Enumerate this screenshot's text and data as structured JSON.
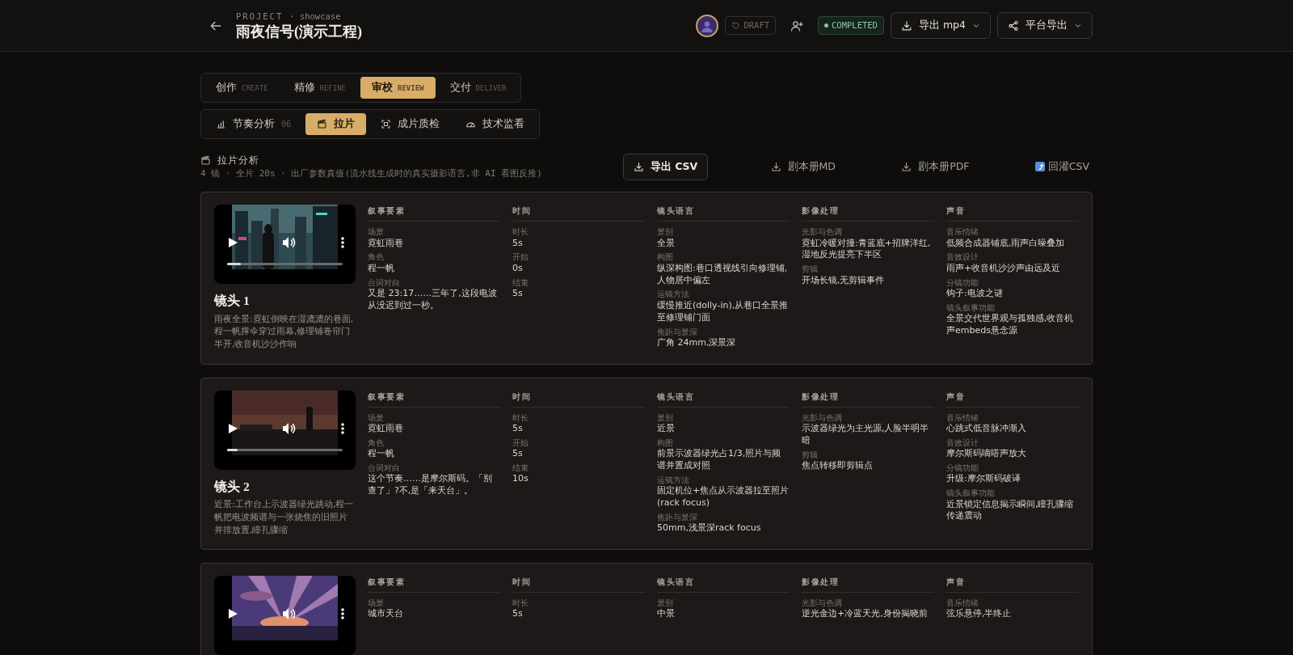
{
  "header": {
    "project_label": "PROJECT",
    "project_sub": "· showcase",
    "title": "雨夜信号(演示工程)",
    "draft": "DRAFT",
    "status": "COMPLETED",
    "buttons": [
      {
        "label": "导出 mp4",
        "kind": "download"
      },
      {
        "label": "平台导出",
        "kind": "share"
      }
    ]
  },
  "stage_tabs": [
    {
      "label": "创作",
      "sub": "CREATE",
      "selected": false
    },
    {
      "label": "精修",
      "sub": "REFINE",
      "selected": false
    },
    {
      "label": "审校",
      "sub": "REVIEW",
      "selected": true
    },
    {
      "label": "交付",
      "sub": "DELIVER",
      "selected": false
    }
  ],
  "sub_tabs": [
    {
      "label": "节奏分析",
      "count": "06",
      "kind": "chart",
      "selected": false
    },
    {
      "label": "拉片",
      "kind": "clapper",
      "selected": true
    },
    {
      "label": "成片质检",
      "kind": "scan",
      "selected": false
    },
    {
      "label": "技术监看",
      "kind": "gauge",
      "selected": false
    }
  ],
  "section": {
    "title": "拉片分析",
    "summary": "4 镜 · 全片 20s · 出厂参数真值(流水线生成时的真实摄影语言,非 AI 看图反推)"
  },
  "actions": [
    {
      "label": "导出 CSV",
      "kind": "primary"
    },
    {
      "label": "剧本册MD",
      "kind": "link"
    },
    {
      "label": "剧本册PDF",
      "kind": "link"
    },
    {
      "label": "回灌CSV",
      "kind": "import"
    }
  ],
  "shots": [
    {
      "title": "镜头 1",
      "description": "雨夜全景:霓虹倒映在湿漉漉的巷面,程一帆撑伞穿过雨幕,修理铺卷帘门半开,收音机沙沙作响",
      "level": 0.12,
      "groups": [
        {
          "heading": "叙事要素",
          "fields": [
            {
              "label": "场景",
              "value": "霓虹雨巷"
            },
            {
              "label": "角色",
              "value": "程一帆"
            },
            {
              "label": "台词对白",
              "value": "又是 23:17……三年了,这段电波从没迟到过一秒。"
            }
          ]
        },
        {
          "heading": "时间",
          "fields": [
            {
              "label": "时长",
              "value": "5s"
            },
            {
              "label": "开始",
              "value": "0s"
            },
            {
              "label": "结束",
              "value": "5s"
            }
          ]
        },
        {
          "heading": "镜头语言",
          "fields": [
            {
              "label": "景别",
              "value": "全景"
            },
            {
              "label": "构图",
              "value": "纵深构图:巷口透视线引向修理铺,人物居中偏左"
            },
            {
              "label": "运镜方法",
              "value": "缓慢推近(dolly-in),从巷口全景推至修理铺门面"
            },
            {
              "label": "焦距与景深",
              "value": "广角 24mm,深景深"
            }
          ]
        },
        {
          "heading": "影像处理",
          "fields": [
            {
              "label": "光影与色调",
              "value": "霓虹冷暖对撞:青蓝底+招牌洋红,湿地反光提亮下半区"
            },
            {
              "label": "剪辑",
              "value": "开场长镜,无剪辑事件"
            }
          ]
        },
        {
          "heading": "声音",
          "fields": [
            {
              "label": "音乐情绪",
              "value": "低频合成器铺底,雨声白噪叠加"
            },
            {
              "label": "音效设计",
              "value": "雨声+收音机沙沙声由远及近"
            },
            {
              "label": "分镜功能",
              "value": "钩子:电波之谜"
            },
            {
              "label": "镜头叙事功能",
              "value": "全景交代世界观与孤独感,收音机声embeds悬念源"
            }
          ]
        }
      ]
    },
    {
      "title": "镜头 2",
      "description": "近景:工作台上示波器绿光跳动,程一帆把电波频谱与一张烧焦的旧照片并排放置,瞳孔骤缩",
      "level": 0.09,
      "groups": [
        {
          "heading": "叙事要素",
          "fields": [
            {
              "label": "场景",
              "value": "霓虹雨巷"
            },
            {
              "label": "角色",
              "value": "程一帆"
            },
            {
              "label": "台词对白",
              "value": "这个节奏……是摩尔斯码。「别查了」?不,是「来天台」。"
            }
          ]
        },
        {
          "heading": "时间",
          "fields": [
            {
              "label": "时长",
              "value": "5s"
            },
            {
              "label": "开始",
              "value": "5s"
            },
            {
              "label": "结束",
              "value": "10s"
            }
          ]
        },
        {
          "heading": "镜头语言",
          "fields": [
            {
              "label": "景别",
              "value": "近景"
            },
            {
              "label": "构图",
              "value": "前景示波器绿光占1/3,照片与频谱并置成对照"
            },
            {
              "label": "运镜方法",
              "value": "固定机位+焦点从示波器拉至照片(rack focus)"
            },
            {
              "label": "焦距与景深",
              "value": "50mm,浅景深rack focus"
            }
          ]
        },
        {
          "heading": "影像处理",
          "fields": [
            {
              "label": "光影与色调",
              "value": "示波器绿光为主光源,人脸半明半暗"
            },
            {
              "label": "剪辑",
              "value": "焦点转移即剪辑点"
            }
          ]
        },
        {
          "heading": "声音",
          "fields": [
            {
              "label": "音乐情绪",
              "value": "心跳式低音脉冲渐入"
            },
            {
              "label": "音效设计",
              "value": "摩尔斯码嘀嗒声放大"
            },
            {
              "label": "分镜功能",
              "value": "升级:摩尔斯码破译"
            },
            {
              "label": "镜头叙事功能",
              "value": "近景锁定信息揭示瞬间,瞳孔骤缩传递震动"
            }
          ]
        }
      ]
    },
    {
      "groups": [
        {
          "heading": "叙事要素",
          "fields": [
            {
              "label": "场景",
              "value": "城市天台"
            }
          ]
        },
        {
          "heading": "时间",
          "fields": [
            {
              "label": "时长",
              "value": "5s"
            }
          ]
        },
        {
          "heading": "镜头语言",
          "fields": [
            {
              "label": "景别",
              "value": "中景"
            }
          ]
        },
        {
          "heading": "影像处理",
          "fields": [
            {
              "label": "光影与色调",
              "value": "逆光金边+冷蓝天光,身份揭晓前"
            }
          ]
        },
        {
          "heading": "声音",
          "fields": [
            {
              "label": "音乐情绪",
              "value": "弦乐悬停,半终止"
            }
          ]
        }
      ]
    }
  ]
}
